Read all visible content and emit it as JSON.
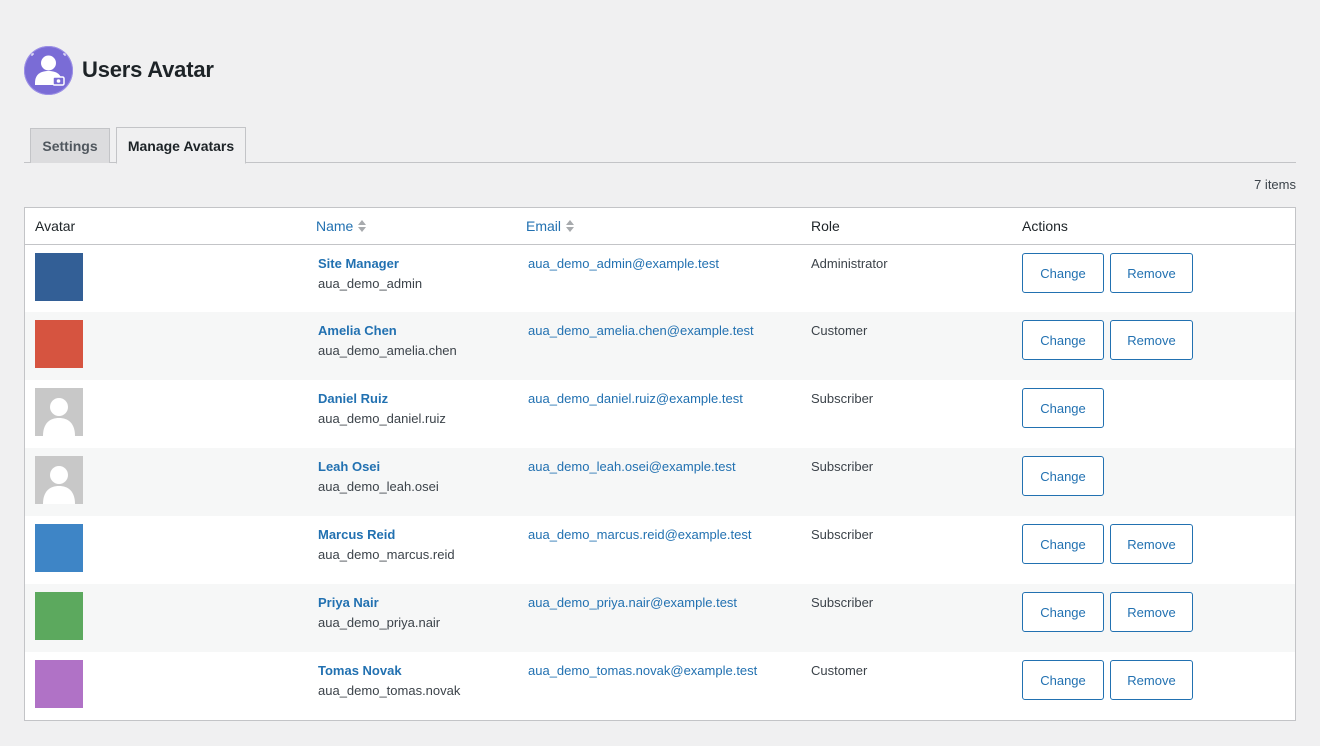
{
  "header": {
    "title": "Users Avatar",
    "logo_icon": "user-avatar-icon"
  },
  "tabs": [
    {
      "label": "Settings",
      "active": false
    },
    {
      "label": "Manage Avatars",
      "active": true
    }
  ],
  "items_count": "7 items",
  "table": {
    "columns": {
      "avatar": "Avatar",
      "name": "Name",
      "email": "Email",
      "role": "Role",
      "actions": "Actions"
    },
    "rows": [
      {
        "avatar_color": "#335f96",
        "placeholder": false,
        "name": "Site Manager",
        "login": "aua_demo_admin",
        "email": "aua_demo_admin@example.test",
        "role": "Administrator",
        "change": "Change",
        "remove": "Remove"
      },
      {
        "avatar_color": "#d65440",
        "placeholder": false,
        "name": "Amelia Chen",
        "login": "aua_demo_amelia.chen",
        "email": "aua_demo_amelia.chen@example.test",
        "role": "Customer",
        "change": "Change",
        "remove": "Remove"
      },
      {
        "avatar_color": "#c8c8c8",
        "placeholder": true,
        "name": "Daniel Ruiz",
        "login": "aua_demo_daniel.ruiz",
        "email": "aua_demo_daniel.ruiz@example.test",
        "role": "Subscriber",
        "change": "Change",
        "remove": null
      },
      {
        "avatar_color": "#c8c8c8",
        "placeholder": true,
        "name": "Leah Osei",
        "login": "aua_demo_leah.osei",
        "email": "aua_demo_leah.osei@example.test",
        "role": "Subscriber",
        "change": "Change",
        "remove": null
      },
      {
        "avatar_color": "#3e85c6",
        "placeholder": false,
        "name": "Marcus Reid",
        "login": "aua_demo_marcus.reid",
        "email": "aua_demo_marcus.reid@example.test",
        "role": "Subscriber",
        "change": "Change",
        "remove": "Remove"
      },
      {
        "avatar_color": "#5ca95e",
        "placeholder": false,
        "name": "Priya Nair",
        "login": "aua_demo_priya.nair",
        "email": "aua_demo_priya.nair@example.test",
        "role": "Subscriber",
        "change": "Change",
        "remove": "Remove"
      },
      {
        "avatar_color": "#b072c6",
        "placeholder": false,
        "name": "Tomas Novak",
        "login": "aua_demo_tomas.novak",
        "email": "aua_demo_tomas.novak@example.test",
        "role": "Customer",
        "change": "Change",
        "remove": "Remove"
      }
    ]
  },
  "colors": {
    "accent": "#2271b1",
    "background": "#f0f0f1",
    "logo": "#7a6cd6"
  }
}
